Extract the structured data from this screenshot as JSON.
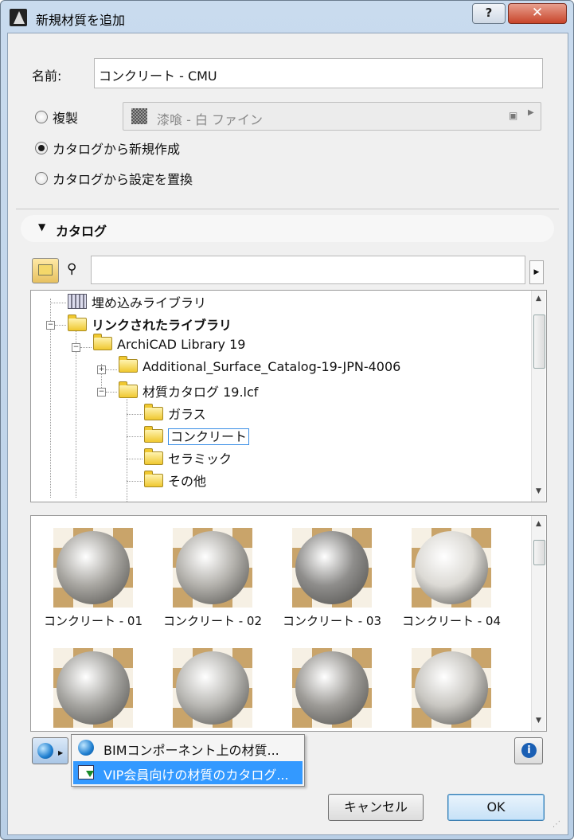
{
  "window": {
    "title": "新規材質を追加",
    "help_label": "?",
    "close_label": "✕"
  },
  "name_field": {
    "label": "名前:",
    "value": "コンクリート - CMU"
  },
  "options": {
    "duplicate_label": "複製",
    "duplicate_value": "漆喰 - 白 ファイン",
    "from_catalog_label": "カタログから新規作成",
    "replace_label": "カタログから設定を置換",
    "selected": "from_catalog"
  },
  "catalog": {
    "header": "カタログ",
    "search_placeholder": ""
  },
  "tree": [
    {
      "label": "埋め込みライブラリ",
      "icon": "library-icon",
      "bold": false
    },
    {
      "label": "リンクされたライブラリ",
      "icon": "library-folder-icon",
      "bold": true
    },
    {
      "label": "ArchiCAD Library 19",
      "icon": "folder-icon",
      "bold": false
    },
    {
      "label": "Additional_Surface_Catalog-19-JPN-4006",
      "icon": "folder-icon",
      "bold": false
    },
    {
      "label": "材質カタログ 19.lcf",
      "icon": "folder-icon",
      "bold": false
    },
    {
      "label": "ガラス",
      "icon": "folder-icon",
      "bold": false
    },
    {
      "label": "コンクリート",
      "icon": "folder-icon",
      "bold": false,
      "selected": true
    },
    {
      "label": "セラミック",
      "icon": "folder-icon",
      "bold": false
    },
    {
      "label": "その他",
      "icon": "folder-icon",
      "bold": false
    }
  ],
  "thumbnails": [
    {
      "label": "コンクリート - 01",
      "color": "#a9a7a2"
    },
    {
      "label": "コンクリート - 02",
      "color": "#b4b2ad"
    },
    {
      "label": "コンクリート - 03",
      "color": "#8f8e8c"
    },
    {
      "label": "コンクリート - 04",
      "color": "#dcdad5"
    },
    {
      "label": "",
      "color": "#a7a6a2"
    },
    {
      "label": "",
      "color": "#b9b8b4"
    },
    {
      "label": "",
      "color": "#9e9c98"
    },
    {
      "label": "",
      "color": "#c9c7c2"
    }
  ],
  "menu": {
    "items": [
      {
        "label": "BIMコンポーネント上の材質...",
        "icon": "globe-icon"
      },
      {
        "label": "VIP会員向けの材質のカタログ...",
        "icon": "catalog-download-icon"
      }
    ]
  },
  "buttons": {
    "cancel": "キャンセル",
    "ok": "OK",
    "info": "i"
  },
  "colors": {
    "selection": "#3399ff",
    "title_bar": "#c9dbee",
    "close": "#c8452b"
  }
}
